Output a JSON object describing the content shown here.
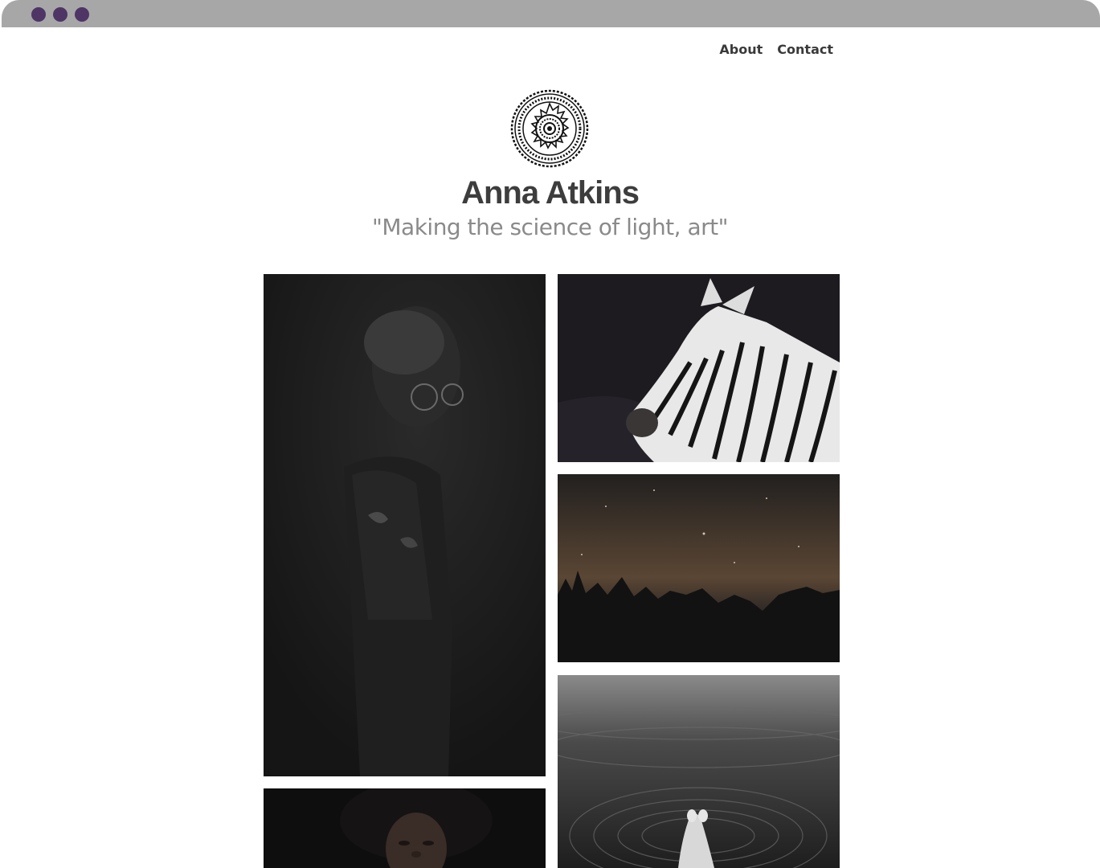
{
  "window": {
    "dot_color": "#4e3566",
    "titlebar_color": "#a7a7a7"
  },
  "nav": {
    "items": [
      {
        "label": "About"
      },
      {
        "label": "Contact"
      }
    ]
  },
  "header": {
    "logo_icon": "mandala-icon",
    "title": "Anna Atkins",
    "tagline": "\"Making the science of light, art\""
  },
  "gallery": {
    "photos": [
      {
        "subject": "man-with-glasses-portrait"
      },
      {
        "subject": "zebra"
      },
      {
        "subject": "night-sky-treeline"
      },
      {
        "subject": "person-floating-in-water"
      },
      {
        "subject": "woman-looking-up-portrait"
      }
    ]
  }
}
